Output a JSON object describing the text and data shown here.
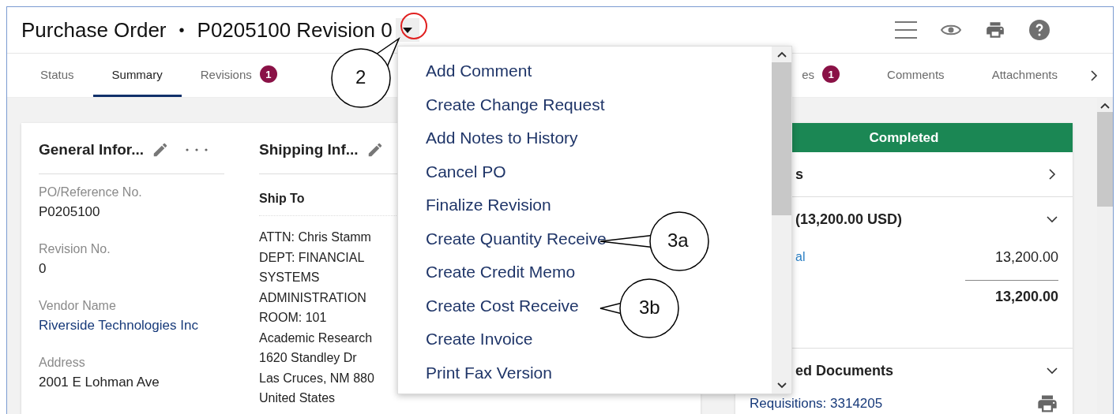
{
  "header": {
    "title": "Purchase Order",
    "separator": "•",
    "document": "P0205100 Revision 0"
  },
  "tabs": [
    {
      "label": "Status",
      "selected": false
    },
    {
      "label": "Summary",
      "selected": true
    },
    {
      "label": "Revisions",
      "selected": false,
      "badge": "1"
    }
  ],
  "tabs_after_menu": [
    {
      "label": "es",
      "selected": false,
      "badge": "1"
    },
    {
      "label": "Comments",
      "selected": false
    },
    {
      "label": "Attachments",
      "selected": false
    }
  ],
  "general_info": {
    "title": "General Infor...",
    "fields": [
      {
        "label": "PO/Reference No.",
        "value": "P0205100",
        "kind": "text"
      },
      {
        "label": "Revision No.",
        "value": "0",
        "kind": "text"
      },
      {
        "label": "Vendor Name",
        "value": "Riverside Technologies Inc",
        "kind": "link"
      },
      {
        "label": "Address",
        "value": "2001 E Lohman Ave",
        "kind": "text"
      }
    ]
  },
  "shipping_info": {
    "title": "Shipping Inf...",
    "subtitle": "Ship To",
    "lines": [
      "ATTN: Chris Stamm",
      "DEPT: FINANCIAL",
      "SYSTEMS",
      "ADMINISTRATION",
      "ROOM: 101",
      "Academic Research",
      "1620 Standley Dr",
      "Las Cruces, NM 880",
      "United States"
    ]
  },
  "status_panel": {
    "status": "Completed",
    "details_title": "s",
    "total_title": "(13,200.00 USD)",
    "line_label": "al",
    "line_amount": "13,200.00",
    "total_amount": "13,200.00",
    "documents_title": "ed Documents",
    "documents_link": "Requisitions: 3314205"
  },
  "menu": {
    "items": [
      "Add Comment",
      "Create Change Request",
      "Add Notes to History",
      "Cancel PO",
      "Finalize Revision",
      "Create Quantity Receive",
      "Create Credit Memo",
      "Create Cost Receive",
      "Create Invoice",
      "Print Fax Version"
    ]
  },
  "callouts": [
    {
      "label": "2"
    },
    {
      "label": "3a"
    },
    {
      "label": "3b"
    }
  ]
}
